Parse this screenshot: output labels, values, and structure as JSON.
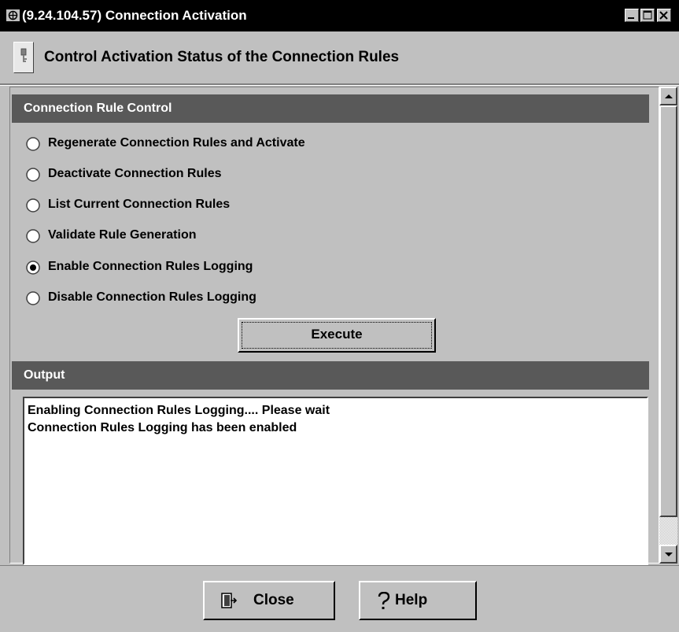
{
  "window": {
    "title": "(9.24.104.57) Connection Activation",
    "buttons": [
      "minimize",
      "maximize",
      "close"
    ]
  },
  "header": {
    "icon": "key-icon",
    "title": "Control Activation Status of the Connection Rules"
  },
  "rule_control": {
    "heading": "Connection Rule Control",
    "options": [
      {
        "label": "Regenerate Connection Rules and Activate",
        "selected": false
      },
      {
        "label": "Deactivate Connection Rules",
        "selected": false
      },
      {
        "label": "List Current Connection Rules",
        "selected": false
      },
      {
        "label": "Validate Rule Generation",
        "selected": false
      },
      {
        "label": "Enable Connection Rules Logging",
        "selected": true
      },
      {
        "label": "Disable Connection Rules Logging",
        "selected": false
      }
    ],
    "execute_label": "Execute"
  },
  "output": {
    "heading": "Output",
    "lines": [
      "Enabling Connection Rules Logging.... Please wait",
      "Connection Rules Logging has been enabled"
    ]
  },
  "footer": {
    "close_label": "Close",
    "help_label": "Help"
  }
}
